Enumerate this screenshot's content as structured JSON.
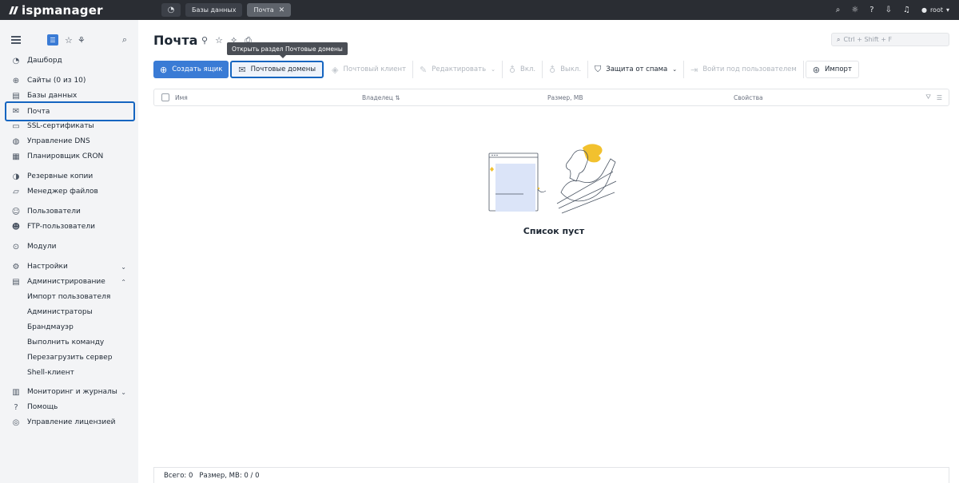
{
  "app": {
    "name": "ispmanager"
  },
  "topbar": {
    "tabs": [
      {
        "label": "Базы данных",
        "active": false
      },
      {
        "label": "Почта",
        "active": true
      }
    ],
    "user": "root"
  },
  "sidebar": {
    "items": [
      {
        "label": "Дашборд",
        "icon": "dashboard-icon"
      },
      {
        "label": "Сайты (0 из 10)",
        "icon": "globe-icon"
      },
      {
        "label": "Базы данных",
        "icon": "database-icon"
      },
      {
        "label": "Почта",
        "icon": "mail-icon",
        "selected": true
      },
      {
        "label": "SSL-сертификаты",
        "icon": "ssl-icon"
      },
      {
        "label": "Управление DNS",
        "icon": "dns-icon"
      },
      {
        "label": "Планировщик CRON",
        "icon": "calendar-icon"
      },
      {
        "label": "Резервные копии",
        "icon": "backup-icon"
      },
      {
        "label": "Менеджер файлов",
        "icon": "folder-icon"
      },
      {
        "label": "Пользователи",
        "icon": "user-icon"
      },
      {
        "label": "FTP-пользователи",
        "icon": "ftp-user-icon"
      },
      {
        "label": "Модули",
        "icon": "modules-icon"
      },
      {
        "label": "Настройки",
        "icon": "settings-icon",
        "expanded": false
      },
      {
        "label": "Администрирование",
        "icon": "admin-icon",
        "expanded": true
      },
      {
        "label": "Импорт пользователя"
      },
      {
        "label": "Администраторы"
      },
      {
        "label": "Брандмауэр"
      },
      {
        "label": "Выполнить команду"
      },
      {
        "label": "Перезагрузить сервер"
      },
      {
        "label": "Shell-клиент"
      },
      {
        "label": "Мониторинг и журналы",
        "icon": "monitoring-icon",
        "expanded": false
      },
      {
        "label": "Помощь",
        "icon": "help-icon"
      },
      {
        "label": "Управление лицензией",
        "icon": "license-icon"
      }
    ]
  },
  "main": {
    "title": "Почта",
    "search_placeholder": "Ctrl + Shift + F",
    "tooltip": "Открыть раздел Почтовые домены",
    "toolbar": {
      "create": "Создать ящик",
      "mail_domains": "Почтовые домены",
      "mail_client": "Почтовый клиент",
      "edit": "Редактировать",
      "on": "Вкл.",
      "off": "Выкл.",
      "spam": "Защита от спама",
      "login_as": "Войти под пользователем",
      "import": "Импорт"
    },
    "table": {
      "columns": [
        "Имя",
        "Владелец",
        "Размер, MB",
        "Свойства"
      ]
    },
    "empty_text": "Список пуст",
    "footer": {
      "total": "Всего: 0",
      "size": "Размер, MB: 0 / 0"
    }
  },
  "colors": {
    "accent": "#3a7bd5",
    "highlight": "#1565c0",
    "topbar": "#2a2d33"
  }
}
